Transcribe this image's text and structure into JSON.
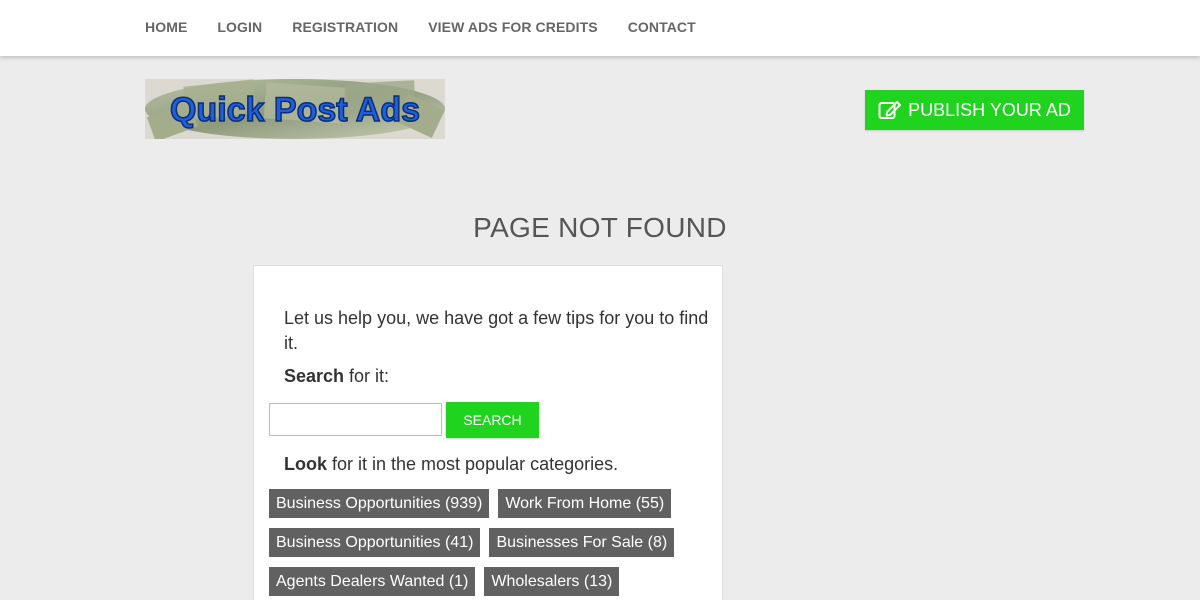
{
  "nav": {
    "items": [
      {
        "label": "HOME"
      },
      {
        "label": "LOGIN"
      },
      {
        "label": "REGISTRATION"
      },
      {
        "label": "VIEW ADS FOR CREDITS"
      },
      {
        "label": "CONTACT"
      }
    ]
  },
  "logo": {
    "text": "Quick Post Ads"
  },
  "header": {
    "publish_label": "PUBLISH YOUR AD",
    "publish_icon": "edit-icon"
  },
  "page": {
    "title": "PAGE NOT FOUND"
  },
  "card": {
    "tip": "Let us help you, we have got a few tips for you to find it.",
    "search_bold": "Search",
    "search_rest": " for it:",
    "search_input_value": "",
    "search_button": "SEARCH",
    "look_bold": "Look",
    "look_rest": " for it in the most popular categories."
  },
  "categories": [
    [
      "Business Opportunities (939)",
      "Work From Home (55)"
    ],
    [
      "Business Opportunities (41)",
      "Businesses For Sale (8)"
    ],
    [
      "Agents Dealers Wanted (1)",
      "Wholesalers (13)"
    ]
  ],
  "colors": {
    "accent": "#1fd31f",
    "category_bg": "#616161",
    "background": "#ececec"
  }
}
